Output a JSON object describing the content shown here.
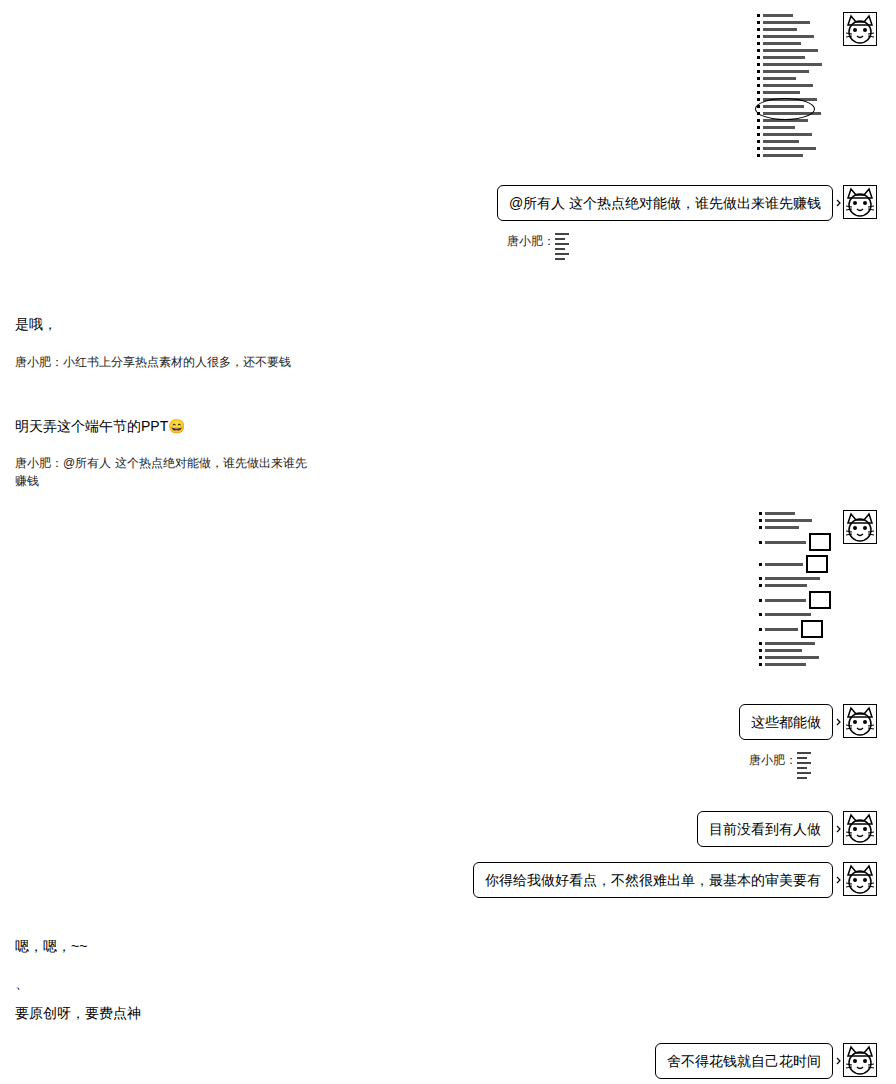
{
  "messages": [
    {
      "kind": "image",
      "side": "right",
      "size": "short"
    },
    {
      "kind": "text",
      "side": "right",
      "text": "@所有人 这个热点绝对能做，谁先做出来谁先赚钱",
      "quote": {
        "author": "唐小肥："
      }
    },
    {
      "kind": "text",
      "side": "left",
      "text": "是哦，"
    },
    {
      "kind": "quote",
      "side": "left",
      "text": "唐小肥：小红书上分享热点素材的人很多，还不要钱"
    },
    {
      "kind": "text",
      "side": "left",
      "text": "明天弄这个端午节的PPT😄"
    },
    {
      "kind": "quote",
      "side": "left",
      "text": "唐小肥：@所有人 这个热点绝对能做，谁先做出来谁先赚钱"
    },
    {
      "kind": "image",
      "side": "right",
      "size": "tall"
    },
    {
      "kind": "text",
      "side": "right",
      "text": "这些都能做",
      "quote": {
        "author": "唐小肥："
      }
    },
    {
      "kind": "text",
      "side": "right",
      "text": "目前没看到有人做"
    },
    {
      "kind": "text",
      "side": "right",
      "text": "你得给我做好看点，不然很难出单，最基本的审美要有"
    },
    {
      "kind": "text",
      "side": "left",
      "text": "嗯，嗯，~~"
    },
    {
      "kind": "text",
      "side": "left",
      "text": "、"
    },
    {
      "kind": "text",
      "side": "left",
      "text": "要原创呀，要费点神"
    },
    {
      "kind": "text",
      "side": "right",
      "text": "舍不得花钱就自己花时间"
    }
  ]
}
